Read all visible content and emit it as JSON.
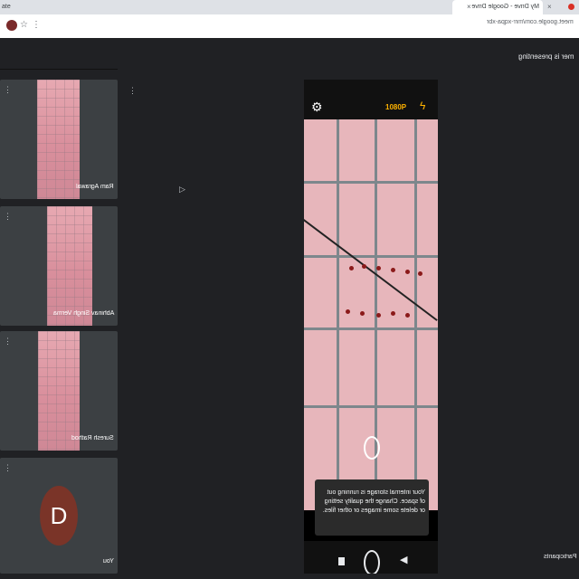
{
  "browser": {
    "tabs": [
      {
        "label": "ate"
      },
      {
        "label": "My Drive - Google Drive"
      },
      {
        "label": ""
      }
    ],
    "address_url": "meet.google.com/mrr-xqpa-xbr",
    "close_glyph": "×",
    "star_glyph": "☆",
    "menu_glyph": "⋮"
  },
  "banner": {
    "text": "mer is presenting"
  },
  "participants": [
    {
      "name": "Ram Agrawal",
      "more": "⋮"
    },
    {
      "name": "Abhinav Singh Verma",
      "more": "⋮"
    },
    {
      "name": "Suresh Rathod",
      "more": "⋮"
    },
    {
      "name": "You",
      "more": "⋮",
      "initial": "D"
    }
  ],
  "stage": {
    "more": "⋮",
    "cursor": "▷",
    "phone": {
      "resolution": "1080P",
      "settings_icon": "gear-icon",
      "flash_icon": "flash-icon",
      "toast": "Your internal storage is running out of space. Change the quality setting or delete some images or other files."
    }
  },
  "sidebar_label": "Participants",
  "colors": {
    "accent": "#ffb300",
    "tile_bg": "#3c4043",
    "page_bg": "#202124"
  }
}
